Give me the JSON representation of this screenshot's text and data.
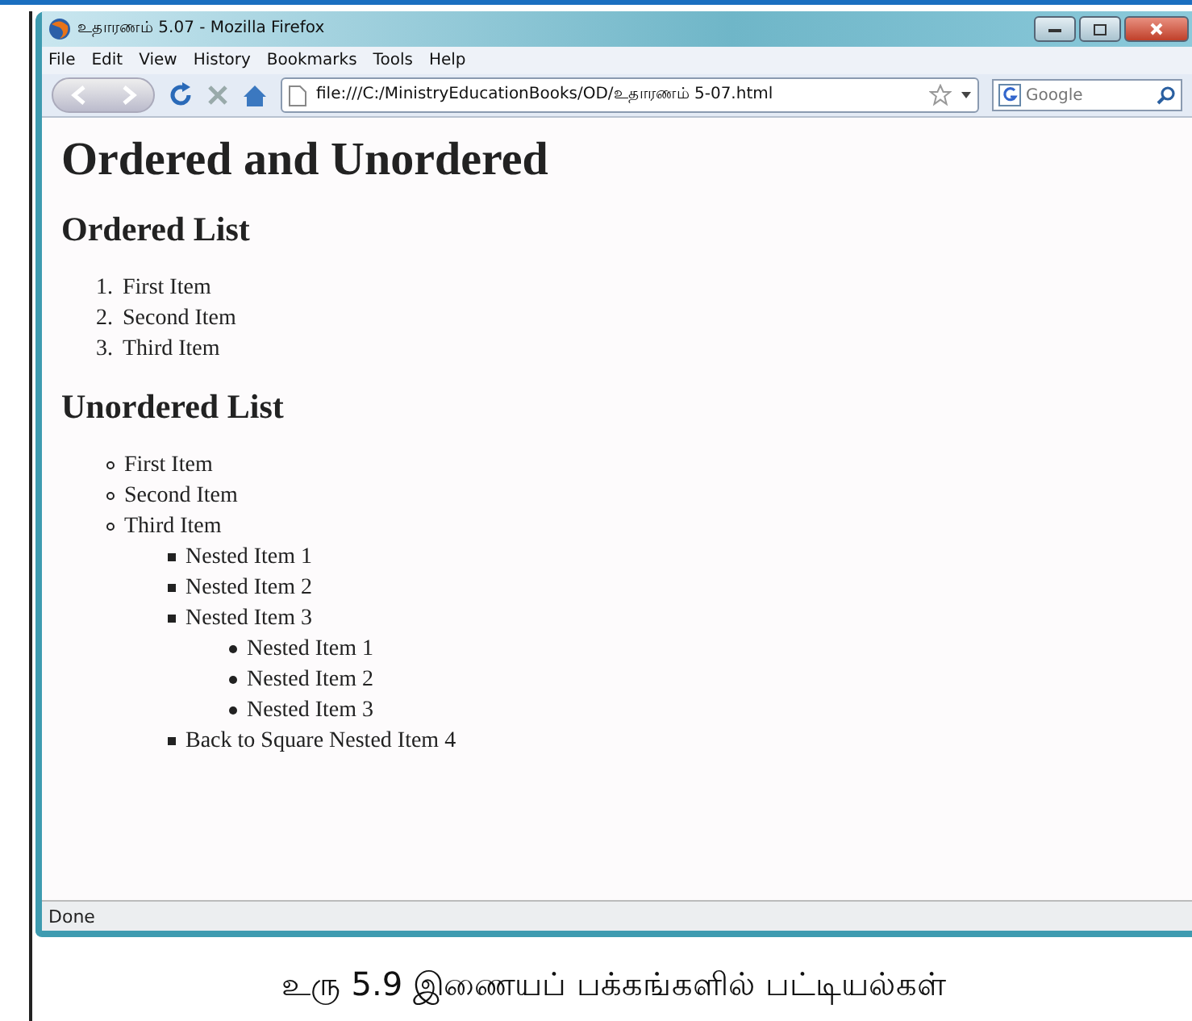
{
  "window": {
    "title": "உதாரணம் 5.07 - Mozilla Firefox"
  },
  "menu": [
    "File",
    "Edit",
    "View",
    "History",
    "Bookmarks",
    "Tools",
    "Help"
  ],
  "address": {
    "value": "file:///C:/MinistryEducationBooks/OD/உதாரணம் 5-07.html"
  },
  "search": {
    "placeholder": "Google"
  },
  "page": {
    "heading": "Ordered and Unordered",
    "sections": [
      {
        "heading": "Ordered List",
        "list": {
          "kind": "ordered",
          "items": [
            {
              "number": "1.",
              "text": "First Item"
            },
            {
              "number": "2.",
              "text": "Second Item"
            },
            {
              "number": "3.",
              "text": "Third Item"
            }
          ]
        }
      },
      {
        "heading": "Unordered List",
        "list": {
          "kind": "circle",
          "items": [
            {
              "text": "First Item"
            },
            {
              "text": "Second Item"
            },
            {
              "text": "Third Item",
              "children": {
                "kind": "square",
                "items": [
                  {
                    "text": "Nested Item 1"
                  },
                  {
                    "text": "Nested Item 2"
                  },
                  {
                    "text": "Nested Item 3",
                    "children": {
                      "kind": "disc",
                      "items": [
                        {
                          "text": "Nested Item 1"
                        },
                        {
                          "text": "Nested Item 2"
                        },
                        {
                          "text": "Nested Item 3"
                        }
                      ]
                    }
                  },
                  {
                    "text": "Back to Square Nested Item 4"
                  }
                ]
              }
            }
          ]
        }
      }
    ]
  },
  "status_bar": "Done",
  "caption": "உரு 5.9   இணையப் பக்கங்களில் பட்டியல்கள்"
}
